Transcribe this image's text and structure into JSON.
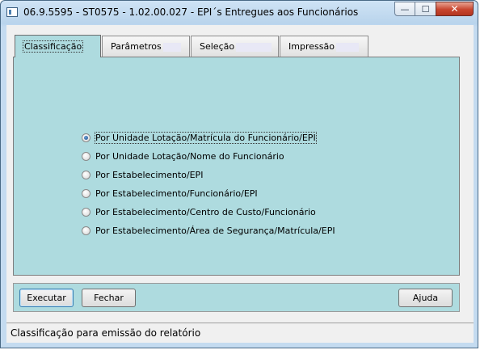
{
  "window": {
    "title": "06.9.5595 - ST0575 - 1.02.00.027 - EPI´s Entregues aos Funcionários",
    "close_symbol": "✕",
    "minimize_symbol": "—",
    "maximize_symbol": "☐"
  },
  "tabs": [
    {
      "label": "Classificação",
      "active": true
    },
    {
      "label": "Parâmetros",
      "active": false
    },
    {
      "label": "Seleção",
      "active": false
    },
    {
      "label": "Impressão",
      "active": false
    }
  ],
  "options": [
    {
      "label": "Por Unidade Lotação/Matrícula do Funcionário/EPI",
      "selected": true
    },
    {
      "label": "Por Unidade Lotação/Nome do Funcionário",
      "selected": false
    },
    {
      "label": "Por Estabelecimento/EPI",
      "selected": false
    },
    {
      "label": "Por Estabelecimento/Funcionário/EPI",
      "selected": false
    },
    {
      "label": "Por Estabelecimento/Centro de Custo/Funcionário",
      "selected": false
    },
    {
      "label": "Por Estabelecimento/Área de Segurança/Matrícula/EPI",
      "selected": false
    }
  ],
  "buttons": {
    "execute": "Executar",
    "close": "Fechar",
    "help": "Ajuda"
  },
  "status": "Classificação para emissão do relatório",
  "colors": {
    "panel": "#aedbdf",
    "close_button": "#c8452e"
  }
}
